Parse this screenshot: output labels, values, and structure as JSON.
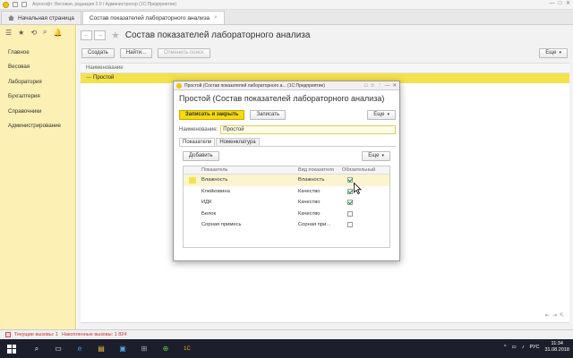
{
  "titlebar": {
    "text": "Агрософт: Весовая, редакция 2.0 / Администратор  (1С:Предприятие)",
    "window_controls": [
      "—",
      "□",
      "✕"
    ]
  },
  "tabs": [
    {
      "label": "Начальная страница",
      "active": false
    },
    {
      "label": "Состав показателей лабораторного анализа",
      "active": true,
      "close": "×"
    }
  ],
  "sidebar": {
    "tools": [
      "☰",
      "★",
      "⟲",
      "⌕",
      "🔔"
    ],
    "items": [
      {
        "label": "Главное"
      },
      {
        "label": "Весовая"
      },
      {
        "label": "Лаборатория"
      },
      {
        "label": "Бухгалтерия"
      },
      {
        "label": "Справочники"
      },
      {
        "label": "Администрирование"
      }
    ]
  },
  "main": {
    "back": "←",
    "forward": "→",
    "star": "★",
    "title": "Состав показателей лабораторного анализа",
    "toolbar": {
      "create": "Создать",
      "find": "Найти...",
      "cancel_search": "Отменить поиск",
      "more": "Еще"
    },
    "list_header": "Наименование",
    "rows": [
      {
        "marker": "—",
        "name": "Простой"
      }
    ],
    "footer_icons": [
      "⇤",
      "⇥",
      "⇱"
    ]
  },
  "modal": {
    "window_title": "Простой (Состав показателей лабораторного а...  (1С:Предприятие)",
    "window_controls": [
      "□",
      "☆",
      "⋮",
      "—",
      "✕"
    ],
    "title": "Простой (Состав показателей лабораторного анализа)",
    "toolbar": {
      "save_close": "Записать и закрыть",
      "save": "Записать",
      "more": "Еще"
    },
    "name_label": "Наименование:",
    "name_value": "Простой",
    "inner_tabs": [
      {
        "label": "Показатели",
        "active": true
      },
      {
        "label": "Номенклатура",
        "active": false
      }
    ],
    "grid_toolbar": {
      "add": "Добавить",
      "more": "Еще"
    },
    "grid": {
      "columns": [
        "Показатель",
        "Вид показателя",
        "Обязательный"
      ],
      "rows": [
        {
          "name": "Влажность",
          "type": "Влажность",
          "required": true,
          "selected": true
        },
        {
          "name": "Клейковина",
          "type": "Качество",
          "required": true,
          "selected": false
        },
        {
          "name": "ИДК",
          "type": "Качество",
          "required": true,
          "selected": false
        },
        {
          "name": "Белок",
          "type": "Качество",
          "required": false,
          "selected": false
        },
        {
          "name": "Сорная примесь",
          "type": "Сорная при...",
          "required": false,
          "selected": false
        }
      ]
    }
  },
  "statusbar": {
    "current_calls": "Текущие вызовы: 1",
    "accumulated_calls": "Накопленные вызовы: 1 824"
  },
  "taskbar": {
    "apps": [
      "⌕",
      "▭",
      "e",
      "▤",
      "▣",
      "⊞",
      "⊕",
      "1C"
    ],
    "lang": "РУС",
    "time": "11:34",
    "date": "31.08.2018",
    "tray_icons": [
      "^",
      "▭",
      "♪"
    ]
  },
  "colors": {
    "accent_yellow": "#f4d90e",
    "sidebar_bg": "#fcf0b5",
    "selected_row": "#f4e24b",
    "taskbar": "#1c1f2b",
    "status_text": "#cc3333"
  }
}
